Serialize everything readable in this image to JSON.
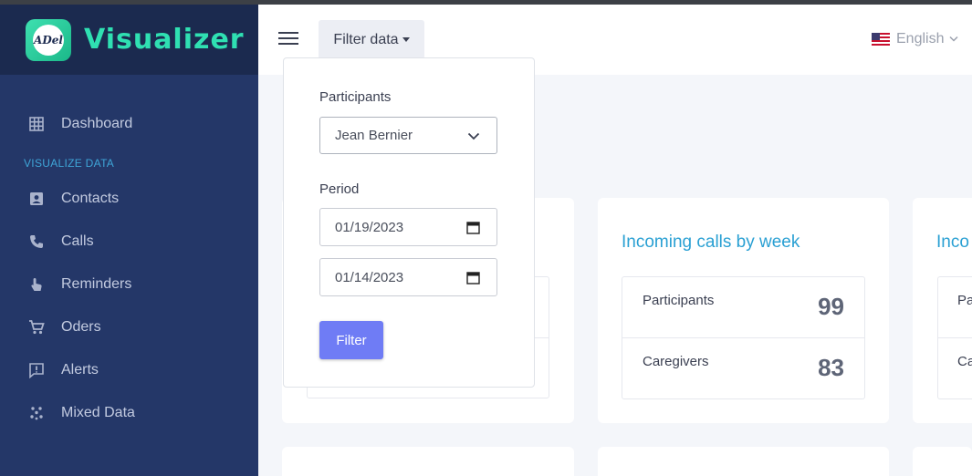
{
  "brand": {
    "name": "Visualizer",
    "logo_text": "ADel"
  },
  "sidebar": {
    "section_label": "VISUALIZE DATA",
    "items": [
      {
        "label": "Dashboard",
        "icon": "grid-icon"
      },
      {
        "label": "Contacts",
        "icon": "contacts-icon"
      },
      {
        "label": "Calls",
        "icon": "phone-icon"
      },
      {
        "label": "Reminders",
        "icon": "hand-icon"
      },
      {
        "label": "Oders",
        "icon": "cart-icon"
      },
      {
        "label": "Alerts",
        "icon": "alert-icon"
      },
      {
        "label": "Mixed Data",
        "icon": "dots-icon"
      }
    ]
  },
  "topbar": {
    "filter_label": "Filter data",
    "language": "English",
    "flag": "us-flag-icon"
  },
  "filter": {
    "participants_label": "Participants",
    "participant_value": "Jean Bernier",
    "period_label": "Period",
    "date_from": "01/19/2023",
    "date_to": "01/14/2023",
    "button_label": "Filter"
  },
  "cards": [
    {
      "title": "Incoming calls by week",
      "rows": [
        {
          "label": "Participants",
          "value": "99"
        },
        {
          "label": "Caregivers",
          "value": "83"
        }
      ]
    },
    {
      "title": "Inco",
      "rows": [
        {
          "label": "Pa",
          "value": ""
        },
        {
          "label": "Ca",
          "value": ""
        }
      ]
    }
  ],
  "colors": {
    "sidebar_bg": "#243768",
    "brand_bg": "#1b2a4f",
    "brand_accent": "#2fe0b2",
    "card_title": "#2aa0d3",
    "button": "#6f7cf5"
  }
}
